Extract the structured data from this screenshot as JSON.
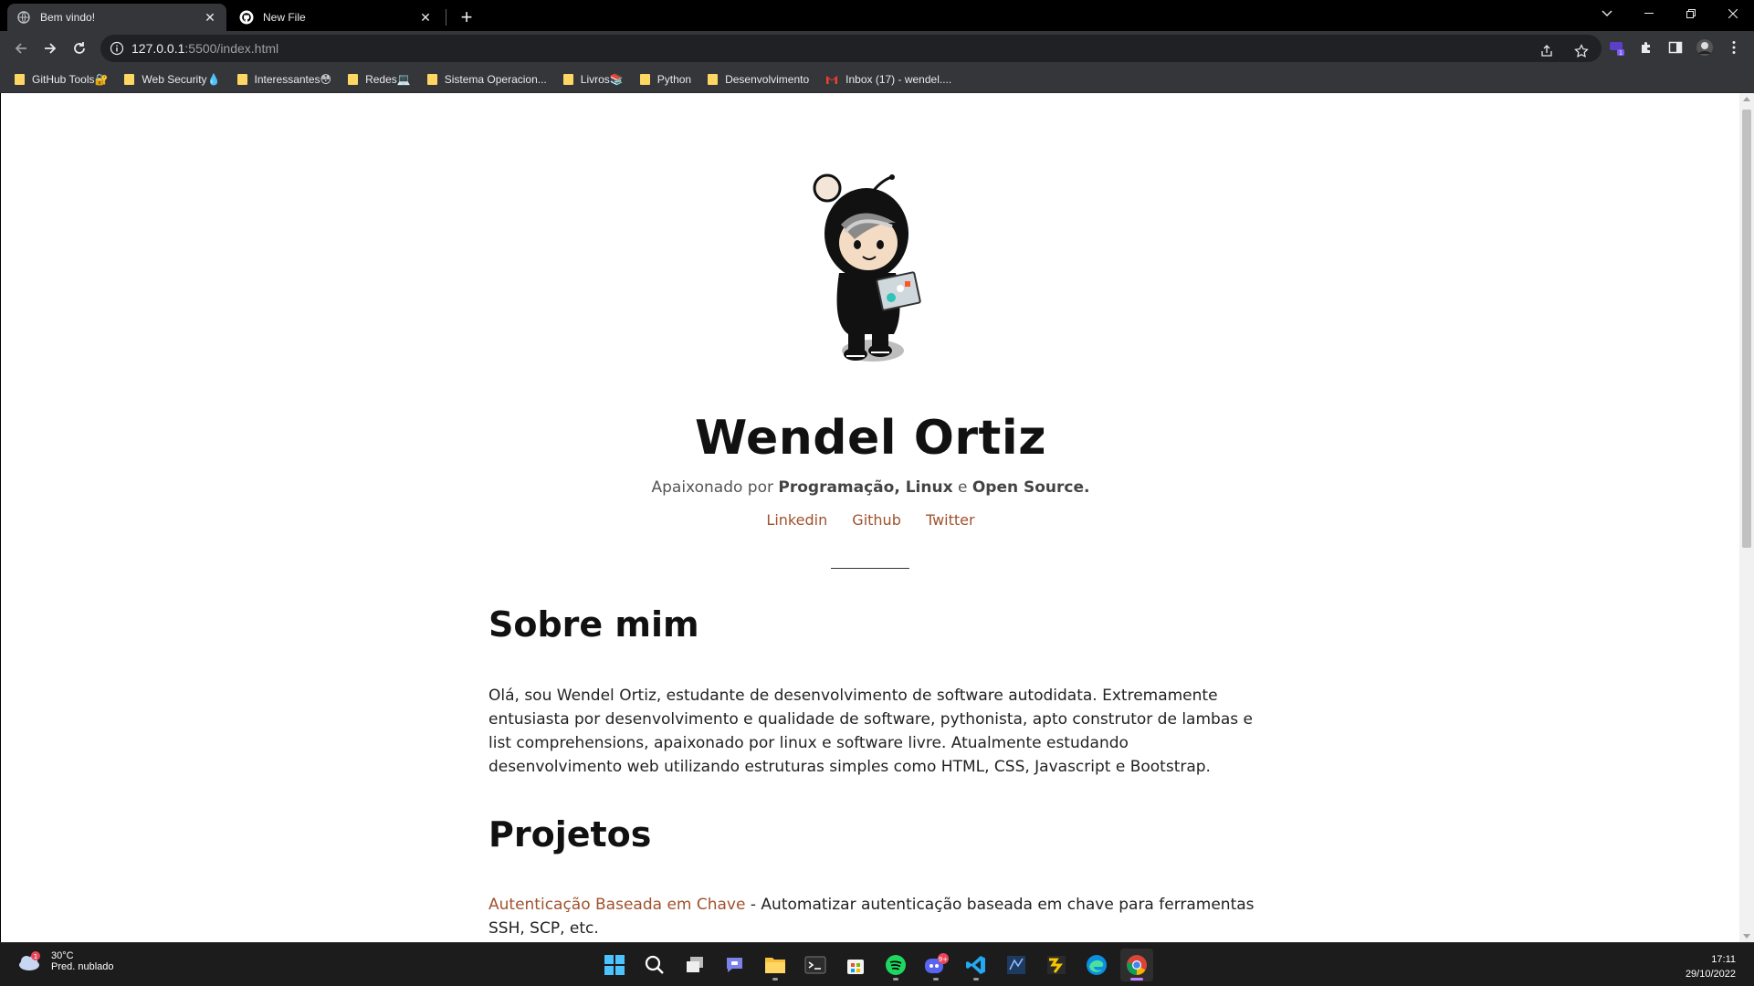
{
  "tabs": [
    {
      "title": "Bem vindo!",
      "active": true
    },
    {
      "title": "New File",
      "active": false
    }
  ],
  "address": {
    "host": "127.0.0.1",
    "rest": ":5500/index.html"
  },
  "bookmarks": [
    {
      "label": "GitHub Tools🔐",
      "type": "folder"
    },
    {
      "label": "Web Security💧",
      "type": "folder"
    },
    {
      "label": "Interessantes😳",
      "type": "folder"
    },
    {
      "label": "Redes💻",
      "type": "folder"
    },
    {
      "label": "Sistema Operacion...",
      "type": "folder"
    },
    {
      "label": "Livros📚",
      "type": "folder"
    },
    {
      "label": "Python",
      "type": "folder"
    },
    {
      "label": "Desenvolvimento",
      "type": "folder"
    },
    {
      "label": "Inbox (17) - wendel....",
      "type": "gmail"
    }
  ],
  "page": {
    "name": "Wendel Ortiz",
    "tagline": {
      "prefix": "Apaixonado por ",
      "bold1": "Programação, Linux",
      "middle": " e ",
      "bold2": "Open Source."
    },
    "social": [
      "Linkedin",
      "Github",
      "Twitter"
    ],
    "about_title": "Sobre mim",
    "about_text": "Olá, sou Wendel Ortiz, estudante de desenvolvimento de software autodidata. Extremamente entusiasta por desenvolvimento e qualidade de software, pythonista, apto construtor de lambas e list comprehensions, apaixonado por linux e software livre. Atualmente estudando desenvolvimento web utilizando estruturas simples como HTML, CSS, Javascript e Bootstrap.",
    "projects_title": "Projetos",
    "project1": {
      "link": "Autenticação Baseada em Chave",
      "desc": " - Automatizar autenticação baseada em chave para ferramentas SSH, SCP, etc."
    }
  },
  "taskbar": {
    "weather_temp": "30°C",
    "weather_desc": "Pred. nublado",
    "weather_badge": "1",
    "discord_badge": "9+",
    "time": "17:11",
    "date": "29/10/2022"
  },
  "colors": {
    "link": "#a0522d",
    "chrome_bg": "#35363a",
    "taskbar_bg": "#1c1c1c"
  }
}
